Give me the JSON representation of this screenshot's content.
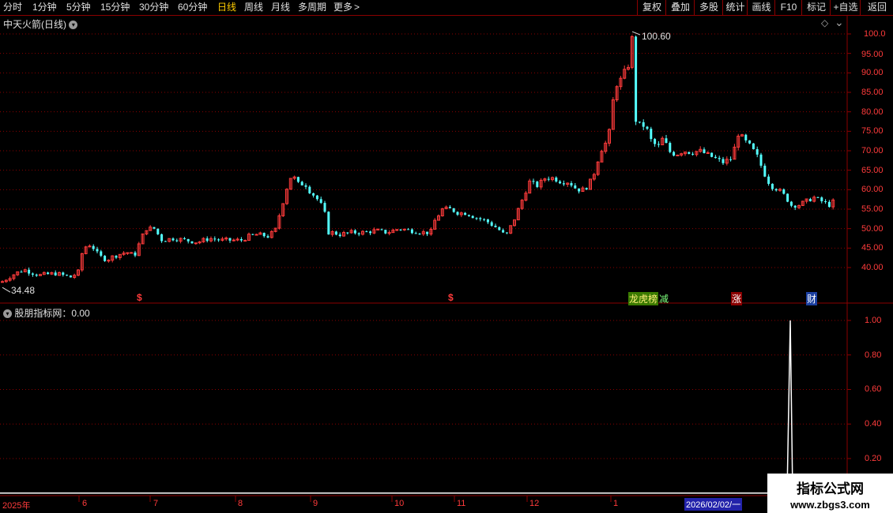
{
  "toolbar": {
    "periods": [
      "分时",
      "1分钟",
      "5分钟",
      "15分钟",
      "30分钟",
      "60分钟",
      "日线",
      "周线",
      "月线",
      "多周期",
      "更多"
    ],
    "more_arrow": ">",
    "right_buttons": [
      "复权",
      "叠加",
      "多股",
      "统计",
      "画线",
      "F10",
      "标记",
      "+自选",
      "返回"
    ]
  },
  "main_panel": {
    "title": "中天火箭(日线)",
    "diamond_icon": "◇",
    "max_label": "100.60",
    "min_label": "34.48",
    "y_ticks": [
      "100.0",
      "95.00",
      "90.00",
      "85.00",
      "80.00",
      "75.00",
      "70.00",
      "65.00",
      "60.00",
      "55.00",
      "50.00",
      "45.00",
      "40.00"
    ],
    "markers": [
      "$",
      "$",
      "龙虎榜",
      "减",
      "涨",
      "财"
    ]
  },
  "indicator_panel": {
    "title": "股朋指标网：0.00",
    "y_ticks": [
      "1.00",
      "0.80",
      "0.60",
      "0.40",
      "0.20"
    ]
  },
  "date_axis": {
    "labels": [
      "2025年",
      "6",
      "7",
      "8",
      "9",
      "10",
      "11",
      "12",
      "1"
    ],
    "cursor_date": "2026/02/02/一"
  },
  "watermark": {
    "line1": "指标公式网",
    "line2": "www.zbgs3.com"
  },
  "colors": {
    "up": "#ff3b3b",
    "down": "#54ffff",
    "grid": "#8b0000",
    "indicator": "#ffffff"
  },
  "chart_data": {
    "type": "candlestick",
    "title": "中天火箭(日线)",
    "ylim": [
      34,
      102
    ],
    "max": 100.6,
    "min": 34.48,
    "close_trend": [
      [
        0,
        36
      ],
      [
        15,
        38
      ],
      [
        30,
        39.5
      ],
      [
        50,
        38
      ],
      [
        70,
        38.5
      ],
      [
        90,
        37.5
      ],
      [
        100,
        39
      ],
      [
        105,
        45
      ],
      [
        115,
        46
      ],
      [
        125,
        43
      ],
      [
        135,
        42
      ],
      [
        145,
        43
      ],
      [
        160,
        44
      ],
      [
        170,
        43
      ],
      [
        180,
        48
      ],
      [
        185,
        50
      ],
      [
        195,
        50
      ],
      [
        205,
        47
      ],
      [
        220,
        47.5
      ],
      [
        235,
        47
      ],
      [
        250,
        46.5
      ],
      [
        265,
        47.5
      ],
      [
        280,
        47
      ],
      [
        295,
        47
      ],
      [
        305,
        47
      ],
      [
        315,
        48
      ],
      [
        325,
        48.5
      ],
      [
        340,
        48
      ],
      [
        350,
        50
      ],
      [
        355,
        55
      ],
      [
        360,
        58
      ],
      [
        365,
        62
      ],
      [
        370,
        64
      ],
      [
        375,
        62
      ],
      [
        380,
        61
      ],
      [
        385,
        62
      ],
      [
        390,
        60
      ],
      [
        400,
        58
      ],
      [
        410,
        55
      ],
      [
        415,
        49
      ],
      [
        420,
        49
      ],
      [
        430,
        48.5
      ],
      [
        445,
        49
      ],
      [
        460,
        49
      ],
      [
        475,
        49.5
      ],
      [
        490,
        49
      ],
      [
        505,
        50
      ],
      [
        520,
        49.5
      ],
      [
        535,
        49
      ],
      [
        545,
        49
      ],
      [
        550,
        52
      ],
      [
        560,
        55
      ],
      [
        570,
        55
      ],
      [
        580,
        54
      ],
      [
        590,
        54
      ],
      [
        600,
        53
      ],
      [
        615,
        52
      ],
      [
        630,
        50
      ],
      [
        640,
        48
      ],
      [
        650,
        52
      ],
      [
        660,
        57
      ],
      [
        670,
        62
      ],
      [
        680,
        61
      ],
      [
        690,
        63
      ],
      [
        700,
        63
      ],
      [
        710,
        62
      ],
      [
        720,
        62
      ],
      [
        730,
        60
      ],
      [
        740,
        60
      ],
      [
        750,
        63
      ],
      [
        760,
        70
      ],
      [
        770,
        73
      ],
      [
        775,
        82
      ],
      [
        780,
        87
      ],
      [
        785,
        88
      ],
      [
        790,
        90
      ],
      [
        795,
        92
      ],
      [
        800,
        99
      ],
      [
        805,
        76
      ],
      [
        812,
        77
      ],
      [
        820,
        75
      ],
      [
        825,
        72
      ],
      [
        835,
        71
      ],
      [
        840,
        74
      ],
      [
        845,
        70
      ],
      [
        855,
        69
      ],
      [
        865,
        70
      ],
      [
        875,
        69.5
      ],
      [
        885,
        70
      ],
      [
        895,
        69
      ],
      [
        905,
        68
      ],
      [
        915,
        67
      ],
      [
        925,
        68
      ],
      [
        930,
        71
      ],
      [
        935,
        75
      ],
      [
        940,
        73
      ],
      [
        950,
        71
      ],
      [
        960,
        68
      ],
      [
        965,
        65
      ],
      [
        970,
        63
      ],
      [
        975,
        61
      ],
      [
        985,
        60
      ],
      [
        995,
        58
      ],
      [
        1000,
        56
      ],
      [
        1010,
        56
      ],
      [
        1020,
        57
      ],
      [
        1030,
        58
      ],
      [
        1040,
        57
      ],
      [
        1050,
        56
      ],
      [
        1055,
        57
      ]
    ],
    "indicator": {
      "name": "股朋指标网",
      "value": 0.0,
      "spike_at": 1000,
      "spike_value": 1.0,
      "ylim": [
        0,
        1.05
      ]
    }
  }
}
